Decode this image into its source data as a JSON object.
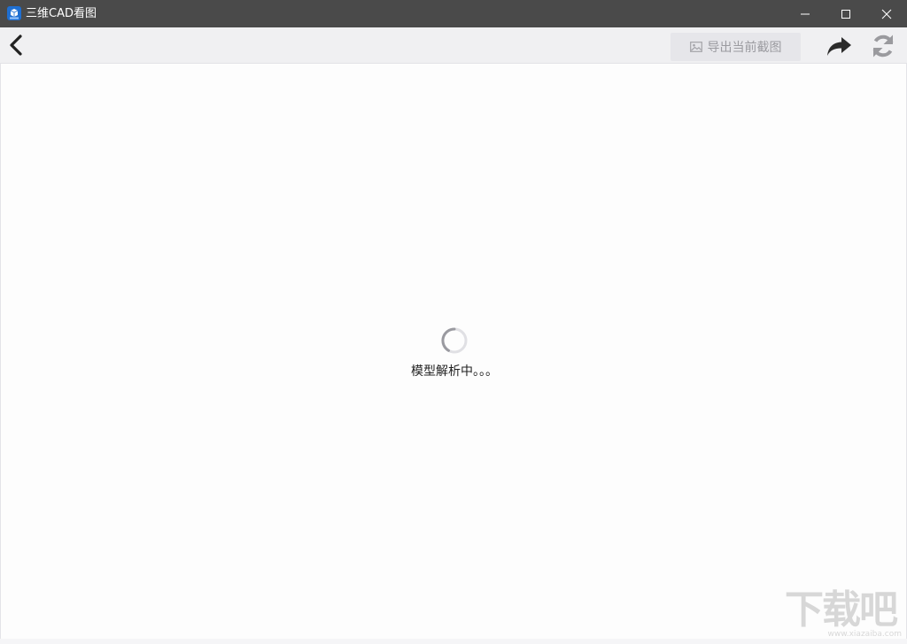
{
  "window": {
    "title": "三维CAD看图",
    "titlebar_color": "#4a4a4a"
  },
  "toolbar": {
    "export_label": "导出当前截图",
    "icons": {
      "back": "chevron-left-icon",
      "export": "image-icon",
      "share": "share-arrow-icon",
      "refresh": "refresh-icon"
    }
  },
  "main": {
    "loading_text": "模型解析中。。。"
  },
  "watermark": {
    "text": "下载吧",
    "subtext": "www.xiazaiba.com"
  }
}
